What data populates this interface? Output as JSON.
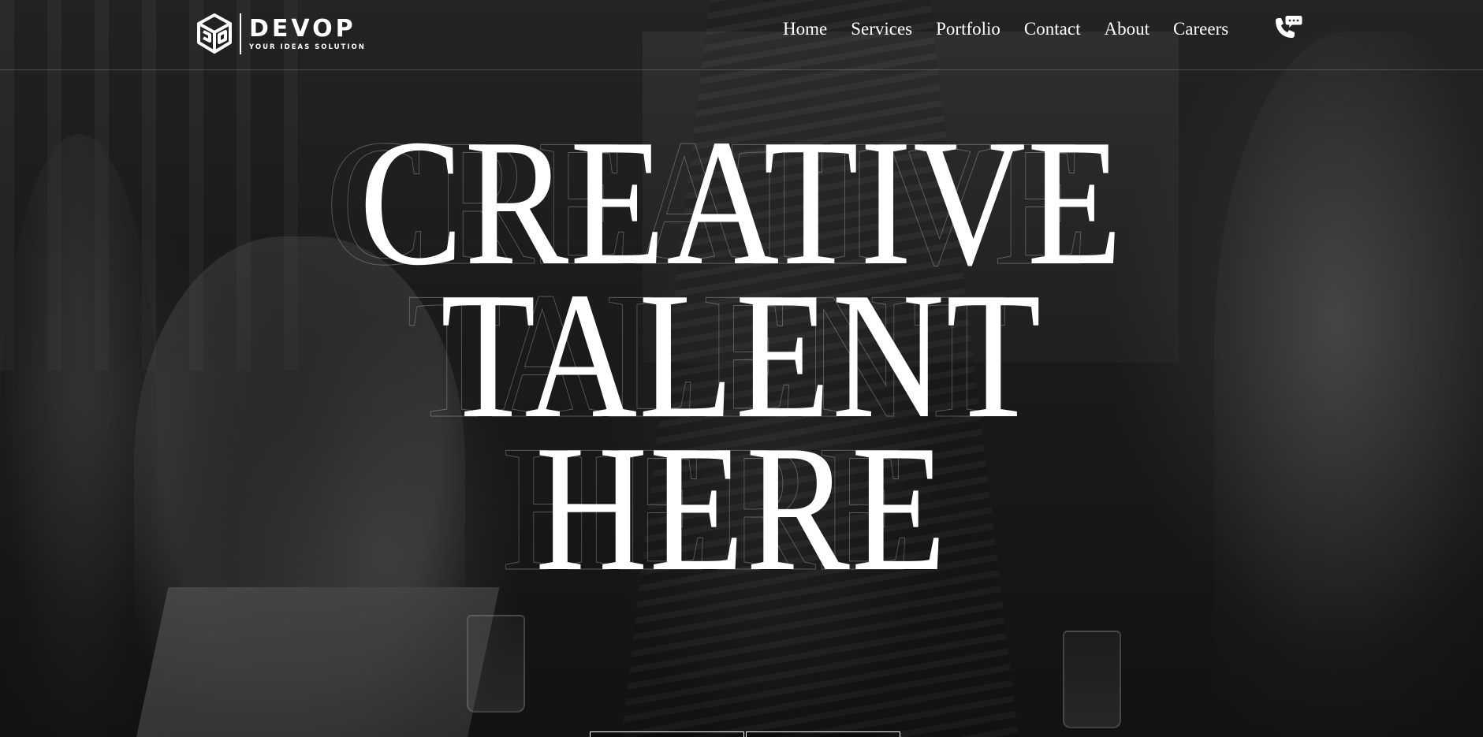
{
  "brand": {
    "name": "DEVOP",
    "tagline": "YOUR IDEAS SOLUTION",
    "logo_icon": "cube-logo-icon"
  },
  "nav": {
    "items": [
      {
        "label": "Home"
      },
      {
        "label": "Services"
      },
      {
        "label": "Portfolio"
      },
      {
        "label": "Contact"
      },
      {
        "label": "About"
      },
      {
        "label": "Careers"
      }
    ],
    "phone_icon": "phone-chat-icon"
  },
  "hero": {
    "lines": [
      "CREATIVE",
      "TALENT",
      "HERE"
    ]
  },
  "colors": {
    "text": "#ffffff",
    "overlay": "#000000"
  }
}
